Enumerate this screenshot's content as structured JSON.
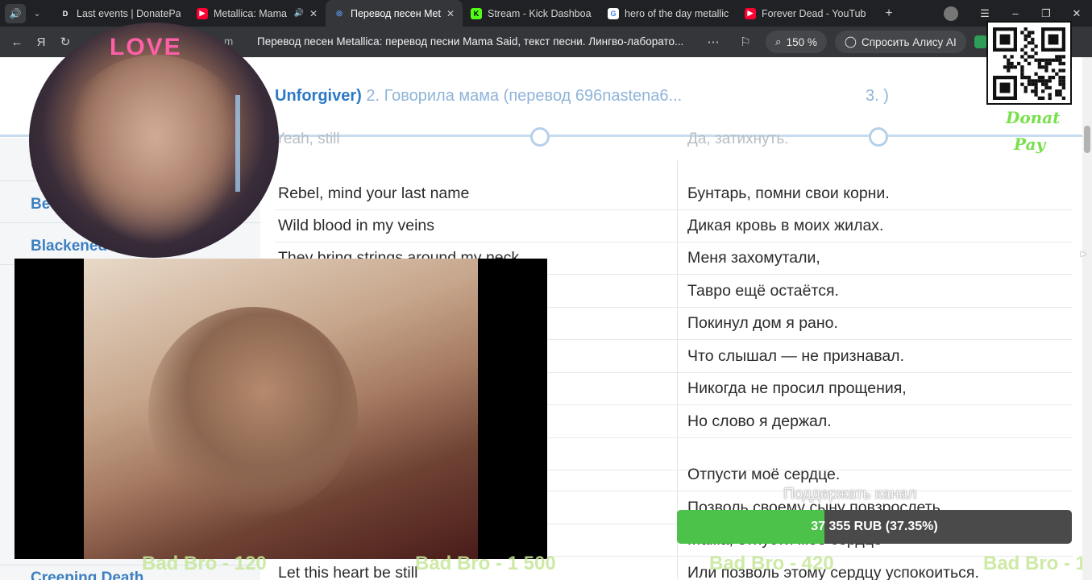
{
  "tabs": [
    {
      "title": "Last events | DonatePay",
      "favicon": "D",
      "favicon_color": "#ffffff",
      "favicon_bg": "#202124",
      "active": false,
      "audio": false
    },
    {
      "title": "Metallica: Mama Said",
      "favicon": "▶",
      "favicon_color": "#ffffff",
      "favicon_bg": "#ff0033",
      "active": false,
      "audio": true
    },
    {
      "title": "Перевод песен Metallica",
      "favicon": "◎",
      "favicon_color": "#5aa0f0",
      "favicon_bg": "transparent",
      "active": true,
      "audio": false
    },
    {
      "title": "Stream - Kick Dashboard",
      "favicon": "K",
      "favicon_color": "#000000",
      "favicon_bg": "#53fc18",
      "active": false,
      "audio": false
    },
    {
      "title": "hero of the day metallica",
      "favicon": "G",
      "favicon_color": "#4285f4",
      "favicon_bg": "#ffffff",
      "active": false,
      "audio": false
    },
    {
      "title": "Forever Dead - YouTube",
      "favicon": "▶",
      "favicon_color": "#ffffff",
      "favicon_bg": "#ff0033",
      "active": false,
      "audio": false
    }
  ],
  "toolbar": {
    "domain_fragment": "m",
    "page_title": "Перевод песен Metallica: перевод песни Mama Said, текст песни. Лингво-лаборато...",
    "zoom": "150 %",
    "ask_alice": "Спросить Алису AI"
  },
  "sidebar": {
    "items": [
      {
        "label": "B"
      },
      {
        "label": "Bet"
      },
      {
        "label": "Blackened"
      },
      {
        "label": "Creeping Death"
      }
    ]
  },
  "song_header": {
    "current": "Unforgiver)",
    "next": "2. Говорила мама (перевод 696nastena6...",
    "third": "3. )"
  },
  "faded_row": {
    "en": "Yeah, still",
    "ru": "Да, затихнуть."
  },
  "lyrics": [
    {
      "en": "Rebel, mind your last name",
      "ru": "Бунтарь, помни свои корни."
    },
    {
      "en": "Wild blood in my veins",
      "ru": "Дикая кровь в моих жилах."
    },
    {
      "en": "They bring strings around my neck",
      "ru": "Меня захомутали,"
    },
    {
      "en": "",
      "ru": "Тавро ещё остаётся."
    },
    {
      "en": "",
      "ru": "Покинул дом я рано."
    },
    {
      "en": "",
      "ru": "Что слышал — не признавал."
    },
    {
      "en": "",
      "ru": "Никогда не просил прощения,"
    },
    {
      "en": "",
      "ru": "Но слово я держал."
    },
    {
      "en": "",
      "ru": ""
    },
    {
      "en": "",
      "ru": "Отпусти моё сердце."
    },
    {
      "en": "",
      "ru": "Позволь своему сыну повзрослеть,"
    },
    {
      "en": "",
      "ru": "Мама, отпусти моё сердце"
    },
    {
      "en": "Let this heart be still",
      "ru": "Или позволь этому сердцу успокоиться."
    }
  ],
  "overlay": {
    "donat": "Donat",
    "pay": "Pay",
    "support_label": "Поддержать канал",
    "donation_text": "37 355 RUB (37.35%)",
    "donation_progress_percent": 37.35,
    "webcam_neon": "LOVE",
    "ticker": [
      "Bad Bro - 120",
      "Bad Bro - 1 500",
      "Bad Bro - 420",
      "Bad Bro - 1"
    ]
  },
  "colors": {
    "accent": "#2c79c5",
    "donation_fill": "#4cc24a",
    "donat_green": "#78e04a"
  }
}
